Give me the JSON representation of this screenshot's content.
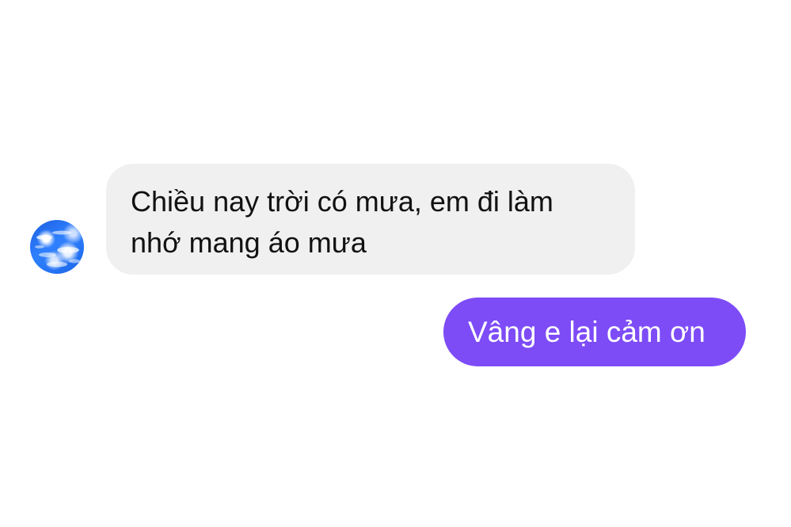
{
  "conversation": {
    "incoming_message": {
      "sender_avatar_icon": "sky-clouds-avatar-icon",
      "text": "Chiều nay trời có mưa, em đi làm\nnhớ mang áo mưa"
    },
    "outgoing_message": {
      "text": "Vâng e lại cảm ơn"
    }
  },
  "colors": {
    "incoming_bubble": "#f0f0f0",
    "incoming_text": "#111111",
    "outgoing_bubble": "#7d4cf7",
    "outgoing_text": "#ffffff",
    "background": "#ffffff"
  }
}
